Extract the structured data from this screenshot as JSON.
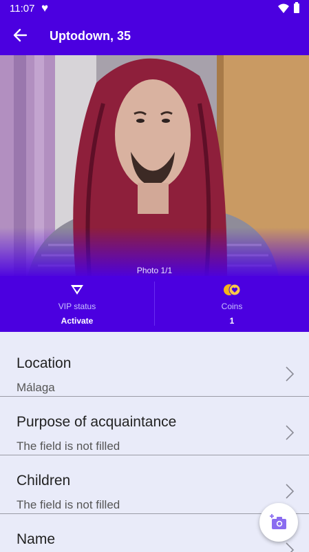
{
  "status_bar": {
    "time": "11:07"
  },
  "app_bar": {
    "title": "Uptodown, 35"
  },
  "photo": {
    "counter": "Photo 1/1"
  },
  "stats": {
    "vip": {
      "label": "VIP status",
      "value": "Activate"
    },
    "coins": {
      "label": "Coins",
      "value": "1"
    }
  },
  "fields": [
    {
      "title": "Location",
      "value": "Málaga"
    },
    {
      "title": "Purpose of acquaintance",
      "value": "The field is not filled"
    },
    {
      "title": "Children",
      "value": "The field is not filled"
    },
    {
      "title": "Name",
      "value": ""
    }
  ],
  "colors": {
    "primary": "#4b00e0",
    "background": "#e9ebf9",
    "coin": "#f4b41a",
    "fab_icon": "#8a6cf0"
  }
}
